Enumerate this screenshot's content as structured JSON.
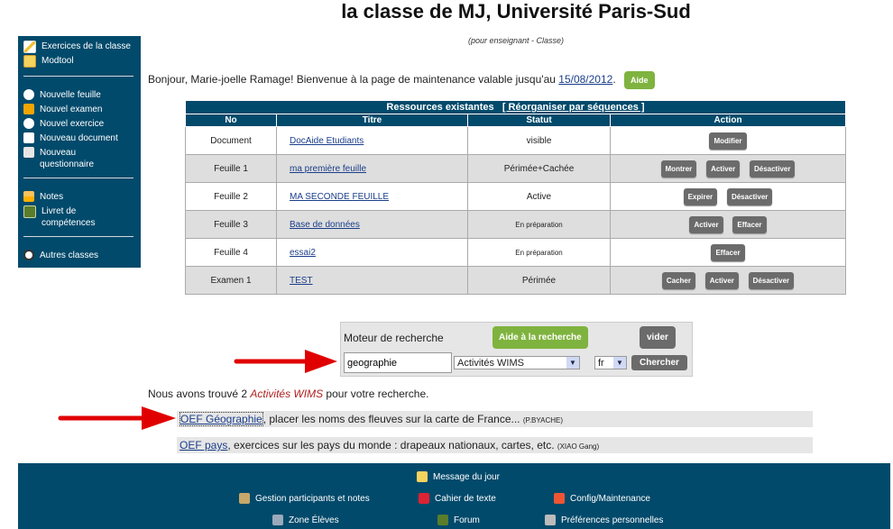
{
  "header": {
    "title": "la classe de MJ, Université Paris-Sud",
    "subtitle": "(pour enseignant - Classe)"
  },
  "sidebar": {
    "items": [
      {
        "label": "Exercices de la classe",
        "icon": "pencil-icon"
      },
      {
        "label": "Modtool",
        "icon": "toolbox-icon"
      },
      {
        "label": "Nouvelle feuille",
        "icon": "sheet-icon"
      },
      {
        "label": "Nouvel examen",
        "icon": "exam-icon"
      },
      {
        "label": "Nouvel exercice",
        "icon": "exercise-icon"
      },
      {
        "label": "Nouveau document",
        "icon": "document-icon"
      },
      {
        "label": "Nouveau questionnaire",
        "icon": "questionnaire-icon"
      },
      {
        "label": "Notes",
        "icon": "chart-icon"
      },
      {
        "label": "Livret de compétences",
        "icon": "book-icon"
      },
      {
        "label": "Autres classes",
        "icon": "classes-icon"
      }
    ]
  },
  "welcome": {
    "text": "Bonjour, Marie-joelle Ramage! Bienvenue à la page de maintenance valable jusqu'au",
    "date": "15/08/2012",
    "help": "Aide"
  },
  "resources": {
    "caption": "Ressources existantes",
    "reorganize": "[ Réorganiser par séquences ]",
    "columns": [
      "No",
      "Titre",
      "Statut",
      "Action"
    ],
    "rows": [
      {
        "no": "Document",
        "titre": "DocAide Etudiants",
        "statut": "visible",
        "actions": [
          "Modifier"
        ]
      },
      {
        "no": "Feuille 1",
        "titre": "ma première feuille",
        "statut": "Périmée+Cachée",
        "actions": [
          "Montrer",
          "Activer",
          "Désactiver"
        ]
      },
      {
        "no": "Feuille 2",
        "titre": "MA SECONDE FEUILLE",
        "statut": "Active",
        "actions": [
          "Expirer",
          "Désactiver"
        ]
      },
      {
        "no": "Feuille 3",
        "titre": "Base de données",
        "statut": "En préparation",
        "actions": [
          "Activer",
          "Effacer"
        ]
      },
      {
        "no": "Feuille 4",
        "titre": "essai2",
        "statut": "En préparation",
        "actions": [
          "Effacer"
        ]
      },
      {
        "no": "Examen 1",
        "titre": "TEST",
        "statut": "Périmée",
        "actions": [
          "Cacher",
          "Activer",
          "Désactiver"
        ]
      }
    ]
  },
  "search": {
    "label": "Moteur de recherche",
    "help": "Aide à la recherche",
    "clear": "vider",
    "query": "geographie",
    "type": "Activités WIMS",
    "lang": "fr",
    "submit": "Chercher"
  },
  "results": {
    "prefix": "Nous avons trouvé 2",
    "type": "Activités WIMS",
    "suffix": "pour votre recherche.",
    "items": [
      {
        "link": "OEF Géographie",
        "desc": ", placer les noms des fleuves sur la carte de France...",
        "author": "(P.BYACHE)"
      },
      {
        "link": "OEF pays",
        "desc": ", exercices sur les pays du monde : drapeaux nationaux, cartes, etc.",
        "author": "(XIAO Gang)"
      }
    ]
  },
  "footer": {
    "message": "Message du jour",
    "gestion": "Gestion participants et notes",
    "cahier": "Cahier de texte",
    "config": "Config/Maintenance",
    "zone": "Zone Élèves",
    "forum": "Forum",
    "prefs": "Préférences personnelles"
  }
}
